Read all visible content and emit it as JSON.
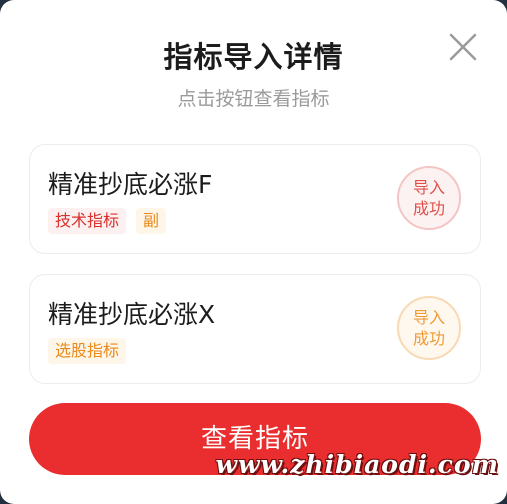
{
  "dialog": {
    "title": "指标导入详情",
    "subtitle": "点击按钮查看指标",
    "close_icon": "close-icon"
  },
  "indicators": [
    {
      "name": "精准抄底必涨F",
      "tags": [
        "技术指标",
        "副"
      ],
      "status_line1": "导入",
      "status_line2": "成功",
      "accent": "#e0504a"
    },
    {
      "name": "精准抄底必涨X",
      "tags": [
        "选股指标"
      ],
      "status_line1": "导入",
      "status_line2": "成功",
      "accent": "#f09a35"
    }
  ],
  "primary_button": {
    "label": "查看指标",
    "color": "#ea2d2e"
  },
  "watermark": "www.zhibiaodi.com"
}
